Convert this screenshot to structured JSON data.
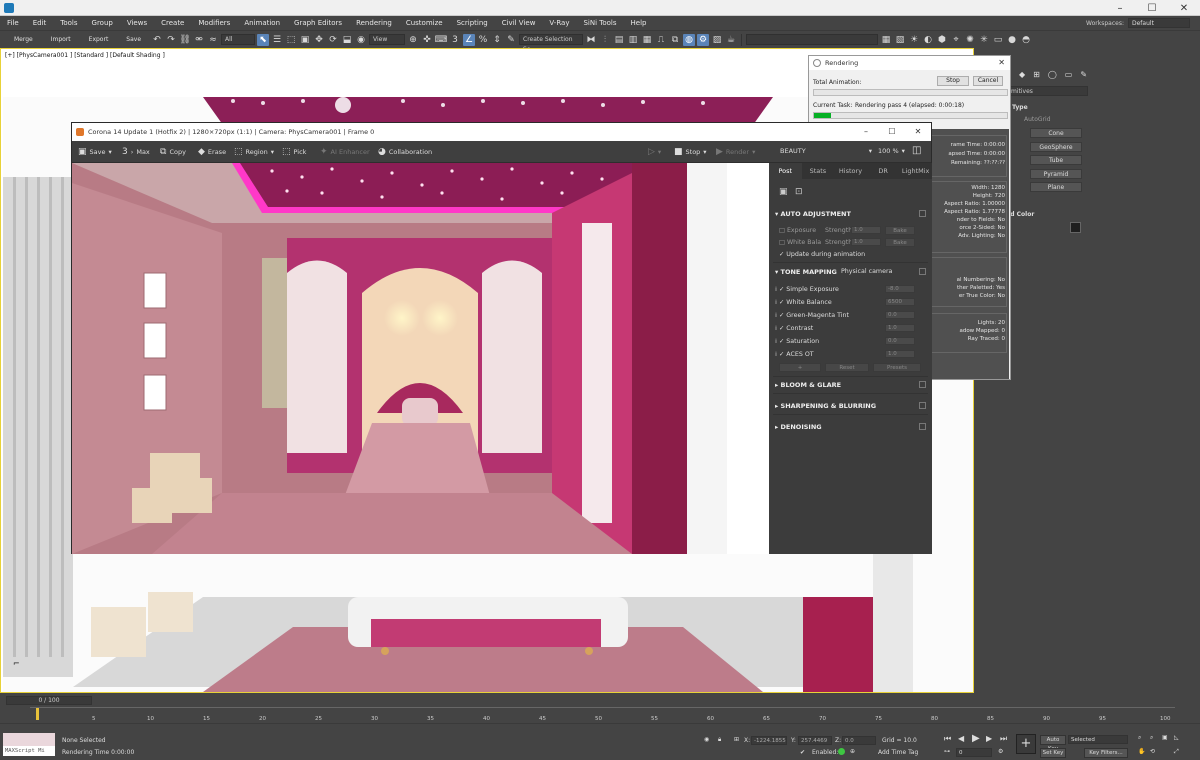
{
  "menu": {
    "items": [
      "File",
      "Edit",
      "Tools",
      "Group",
      "Views",
      "Create",
      "Modifiers",
      "Animation",
      "Graph Editors",
      "Rendering",
      "Customize",
      "Scripting",
      "Civil View",
      "V-Ray",
      "SiNi Tools",
      "Help"
    ],
    "workspaces_label": "Workspaces:",
    "workspaces_value": "Default"
  },
  "toolbar": {
    "merge": "Merge",
    "import": "Import",
    "export": "Export",
    "save": "Save",
    "filter_select": "All",
    "view_select": "View",
    "selection_set": "Create Selection Se"
  },
  "viewport": {
    "label": "[+] [PhysCamera001 ] [Standard ] [Default Shading ]"
  },
  "command_panel": {
    "dropdown": "mitives",
    "type_head": "Type",
    "autogrid": "AutoGrid",
    "buttons": [
      "Cone",
      "GeoSphere",
      "Tube",
      "Pyramid",
      "Plane"
    ],
    "color_head": "nd Color"
  },
  "render_dialog": {
    "title": "Rendering",
    "total_animation": "Total Animation:",
    "stop": "Stop",
    "cancel": "Cancel",
    "current_task_label": "Current Task:",
    "current_task": "Rendering pass 4 (elapsed: 0:00:18)",
    "animation_progress": 0,
    "task_progress": 0.09,
    "stats": {
      "frame_time": "rame Time:  0:00:00",
      "elapsed": "apsed Time:  0:00:00",
      "remaining": "Remaining:  ??:??:??",
      "width": "Width: 1280",
      "height": "Height: 720",
      "aspect": "Aspect Ratio: 1.00000",
      "image_aspect": "Aspect Ratio: 1.77778",
      "fields": "nder to Fields: No",
      "two_sided": "orce 2-Sided: No",
      "adv_lighting": "Adv. Lighting: No",
      "numbering": "al Numbering: No",
      "paletted": "ther Paletted: Yes",
      "true_color": "er True Color: No",
      "lights": "Lights: 20",
      "shadow_mapped": "adow Mapped: 0",
      "ray_traced": "Ray Traced: 0"
    }
  },
  "vfb": {
    "title": "Corona 14 Update 1 (Hotfix 2) | 1280×720px (1:1) | Camera: PhysCamera001 | Frame 0",
    "save": "Save",
    "max": "Max",
    "copy": "Copy",
    "erase": "Erase",
    "region": "Region",
    "pick": "Pick",
    "ai_enhancer": "AI Enhancer",
    "collaboration": "Collaboration",
    "stop": "Stop",
    "render": "Render",
    "channel": "BEAUTY",
    "zoom": "100 %",
    "tabs": [
      "Post",
      "Stats",
      "History",
      "DR",
      "LightMix"
    ],
    "auto_adjustment": "AUTO ADJUSTMENT",
    "exposure": "Exposure",
    "white_balance": "White Bala",
    "strength": "Strength",
    "strength_value": "1.0",
    "bake": "Bake",
    "update_during_animation": "Update during animation",
    "tone_mapping": "TONE MAPPING",
    "tone_preset": "Physical camera",
    "simple_exposure": "Simple Exposure",
    "simple_exposure_value": "-8.0",
    "white_balance_tm": "White Balance",
    "white_balance_value": "6500",
    "green_magenta": "Green-Magenta Tint",
    "green_magenta_value": "0.0",
    "contrast": "Contrast",
    "contrast_value": "1.0",
    "saturation": "Saturation",
    "saturation_value": "0.0",
    "aces": "ACES OT",
    "aces_value": "1.0",
    "plus": "+",
    "reset": "Reset",
    "presets": "Presets",
    "bloom": "BLOOM & GLARE",
    "sharpening": "SHARPENING & BLURRING",
    "denoising": "DENOISING"
  },
  "timeline": {
    "slider": "0 / 100",
    "ticks": [
      "5",
      "10",
      "15",
      "20",
      "25",
      "30",
      "35",
      "40",
      "45",
      "50",
      "55",
      "60",
      "65",
      "70",
      "75",
      "80",
      "85",
      "90",
      "95",
      "100"
    ]
  },
  "status": {
    "maxscript": "MAXScript Mi",
    "none_selected": "None Selected",
    "rendering_time": "Rendering Time  0:00:00",
    "x_label": "X:",
    "x_value": "-1224.1855",
    "y_label": "Y:",
    "y_value": "257.4469",
    "z_label": "Z:",
    "z_value": "0.0",
    "grid": "Grid = 10.0",
    "enabled": "Enabled:",
    "add_time_tag": "Add Time Tag",
    "auto_key": "Auto Key",
    "selected": "Selected",
    "set_key": "Set Key",
    "key_filters": "Key Filters...",
    "frame_value": "0"
  }
}
